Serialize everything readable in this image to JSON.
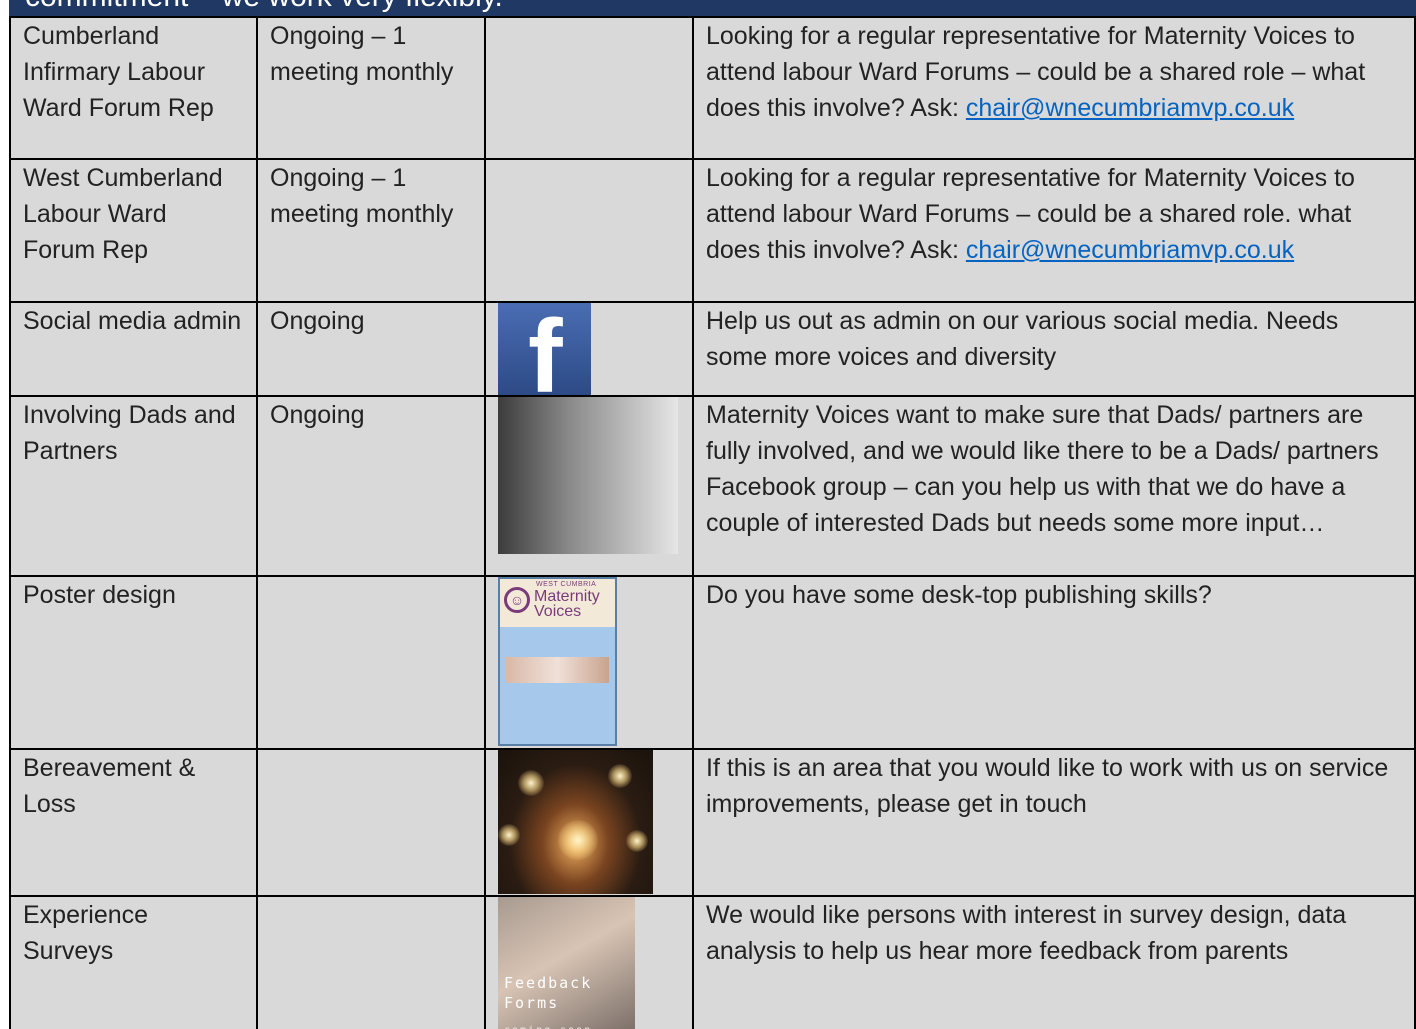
{
  "header": {
    "text": "commitment – we work very flexibly."
  },
  "rows": [
    {
      "role": "Cumberland Infirmary Labour Ward Forum Rep",
      "frequency": "Ongoing – 1 meeting monthly",
      "description": "Looking for a regular representative for Maternity Voices to attend labour Ward Forums – could be a shared role – what does this involve? Ask: ",
      "email": "chair@wnecumbriamvp.co.uk"
    },
    {
      "role": "West Cumberland Labour Ward Forum Rep",
      "frequency": "Ongoing – 1 meeting monthly",
      "description": "Looking for a regular representative for Maternity Voices to attend labour Ward Forums – could be a shared role. what does this involve? Ask: ",
      "email": "chair@wnecumbriamvp.co.uk"
    },
    {
      "role": "Social media admin",
      "frequency": "Ongoing",
      "image_icon": "facebook-logo-icon",
      "description": "Help us out as admin on our various social media.  Needs some more voices and diversity"
    },
    {
      "role": "Involving Dads and Partners",
      "frequency": "Ongoing",
      "description": "Maternity Voices want to make sure that Dads/ partners are fully involved, and we would like there to be a Dads/ partners Facebook group – can you help us with that we do have a couple of interested Dads but needs some more input…"
    },
    {
      "role": "Poster design",
      "frequency": "",
      "poster_small": "WEST CUMBRIA",
      "poster_large": "Maternity Voices",
      "description": "Do you have some desk-top publishing skills?"
    },
    {
      "role": "Bereavement & Loss",
      "frequency": "",
      "description": "If this is an area that you would like to work with us on service improvements, please get in touch"
    },
    {
      "role": "Experience Surveys",
      "frequency": "",
      "image_text": "Feedback Forms",
      "image_subtext": "coming soon...",
      "description": "We would like persons with interest in survey design, data analysis to help us hear more feedback from parents"
    }
  ]
}
